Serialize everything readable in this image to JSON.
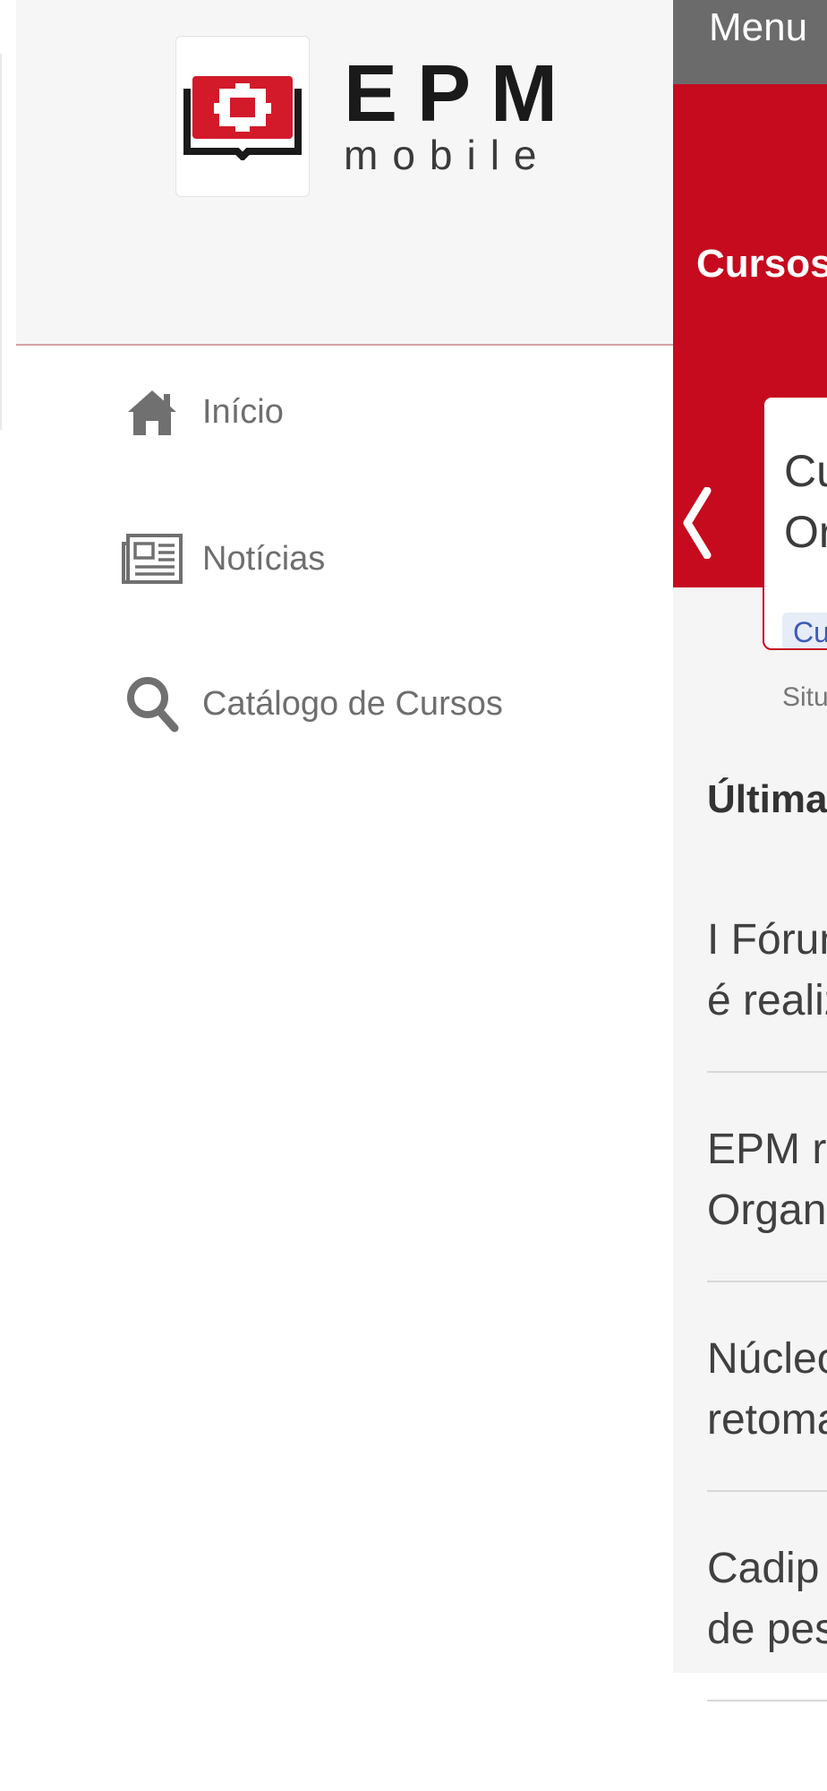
{
  "app": {
    "logo": {
      "brand": "EPM",
      "sub": "mobile"
    }
  },
  "drawer": {
    "items": [
      {
        "label": "Início",
        "icon": "home-icon"
      },
      {
        "label": "Notícias",
        "icon": "newspaper-icon"
      },
      {
        "label": "Catálogo de Cursos",
        "icon": "search-icon"
      }
    ]
  },
  "main": {
    "topbar_title": "Menu",
    "section_title": "Cursos",
    "card": {
      "title_lines": "Cu\nOr",
      "chip": "Cu"
    },
    "situation_label": "Situ",
    "news_heading": "Últimas",
    "news": [
      "I Fórun\né realiz",
      "EPM re\nOrgani",
      "Núcleo\nretoma",
      "Cadip\nde pes"
    ]
  },
  "colors": {
    "brand_red": "#c60b1e",
    "topbar_gray": "#6b6b6b",
    "drawer_text": "#6e6e6e"
  }
}
